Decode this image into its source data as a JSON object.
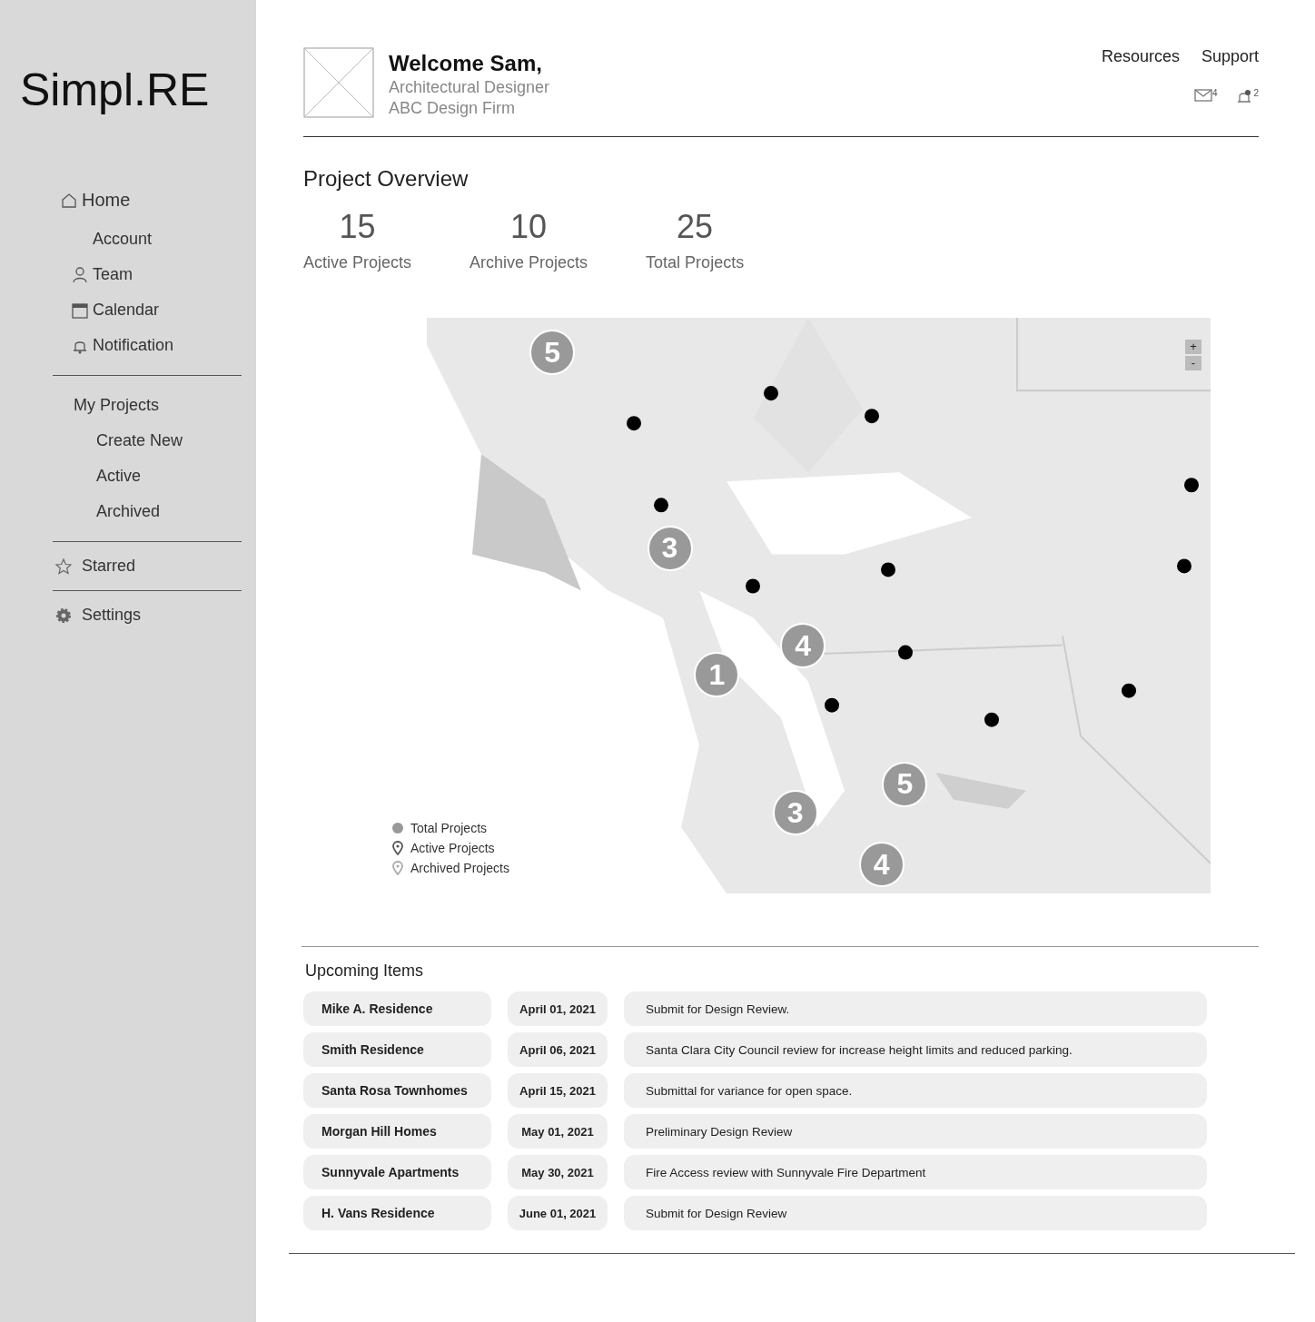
{
  "logo": "Simpl.RE",
  "nav": {
    "label": "Home",
    "children": [
      "Account",
      "Team",
      "Calendar",
      "Notification"
    ]
  },
  "projects_nav": {
    "label": "My Projects",
    "items": [
      "Create New",
      "Active",
      "Archived"
    ]
  },
  "starred": "Starred",
  "settings": "Settings",
  "user": {
    "greeting": "Welcome Sam,",
    "role": "Architectural Designer",
    "firm": "ABC Design Firm"
  },
  "top_links": [
    "Resources",
    "Support"
  ],
  "badges": {
    "mail": "4",
    "notifications": "2"
  },
  "overview": {
    "title": "Project Overview",
    "stats": [
      {
        "value": "15",
        "label": "Active Projects"
      },
      {
        "value": "10",
        "label": "Archive Projects"
      },
      {
        "value": "25",
        "label": "Total Projects"
      }
    ]
  },
  "map": {
    "markers": [
      "5",
      "3",
      "4",
      "1",
      "5",
      "3",
      "4"
    ],
    "zoom": [
      "+",
      "-"
    ],
    "legend": [
      {
        "kind": "dot",
        "label": "Total Projects"
      },
      {
        "kind": "pin",
        "label": "Active Projects"
      },
      {
        "kind": "pin-light",
        "label": "Archived Projects"
      }
    ]
  },
  "upcoming": {
    "title": "Upcoming Items",
    "rows": [
      {
        "project": "Mike A. Residence",
        "date": "April 01, 2021",
        "task": "Submit for Design Review."
      },
      {
        "project": "Smith Residence",
        "date": "April 06, 2021",
        "task": "Santa Clara City Council review for increase height limits and reduced parking."
      },
      {
        "project": "Santa Rosa Townhomes",
        "date": "April 15, 2021",
        "task": "Submittal for variance for open space."
      },
      {
        "project": "Morgan Hill Homes",
        "date": "May 01, 2021",
        "task": "Preliminary Design Review"
      },
      {
        "project": "Sunnyvale Apartments",
        "date": "May 30, 2021",
        "task": "Fire Access review with Sunnyvale Fire Department"
      },
      {
        "project": "H. Vans Residence",
        "date": "June 01, 2021",
        "task": "Submit for Design Review"
      }
    ]
  }
}
